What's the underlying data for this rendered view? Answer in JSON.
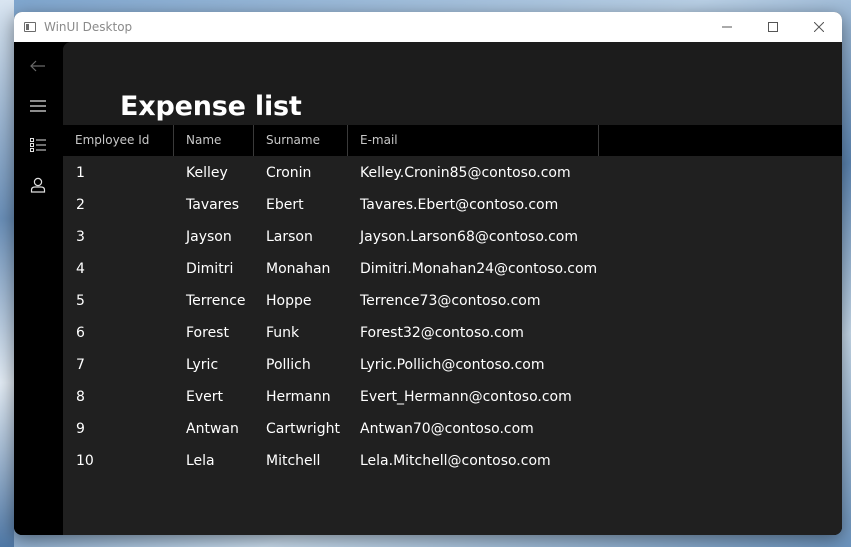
{
  "window": {
    "title": "WinUI Desktop",
    "minimize_glyph": "—",
    "maximize_glyph": "☐",
    "close_glyph": "✕"
  },
  "nav": {
    "items": [
      {
        "icon": "back-arrow-icon"
      },
      {
        "icon": "hamburger-menu-icon"
      },
      {
        "icon": "list-icon"
      },
      {
        "icon": "person-icon"
      }
    ]
  },
  "page": {
    "title": "Expense list"
  },
  "table": {
    "columns": [
      "Employee Id",
      "Name",
      "Surname",
      "E-mail"
    ],
    "rows": [
      {
        "id": "1",
        "name": "Kelley",
        "surname": "Cronin",
        "email": "Kelley.Cronin85@contoso.com"
      },
      {
        "id": "2",
        "name": "Tavares",
        "surname": "Ebert",
        "email": "Tavares.Ebert@contoso.com"
      },
      {
        "id": "3",
        "name": "Jayson",
        "surname": "Larson",
        "email": "Jayson.Larson68@contoso.com"
      },
      {
        "id": "4",
        "name": "Dimitri",
        "surname": "Monahan",
        "email": "Dimitri.Monahan24@contoso.com"
      },
      {
        "id": "5",
        "name": "Terrence",
        "surname": "Hoppe",
        "email": "Terrence73@contoso.com"
      },
      {
        "id": "6",
        "name": "Forest",
        "surname": "Funk",
        "email": "Forest32@contoso.com"
      },
      {
        "id": "7",
        "name": "Lyric",
        "surname": "Pollich",
        "email": "Lyric.Pollich@contoso.com"
      },
      {
        "id": "8",
        "name": "Evert",
        "surname": "Hermann",
        "email": "Evert_Hermann@contoso.com"
      },
      {
        "id": "9",
        "name": "Antwan",
        "surname": "Cartwright",
        "email": "Antwan70@contoso.com"
      },
      {
        "id": "10",
        "name": "Lela",
        "surname": "Mitchell",
        "email": "Lela.Mitchell@contoso.com"
      }
    ]
  },
  "colors": {
    "content_bg": "#202020",
    "header_bg": "#000000",
    "text": "#ffffff"
  }
}
